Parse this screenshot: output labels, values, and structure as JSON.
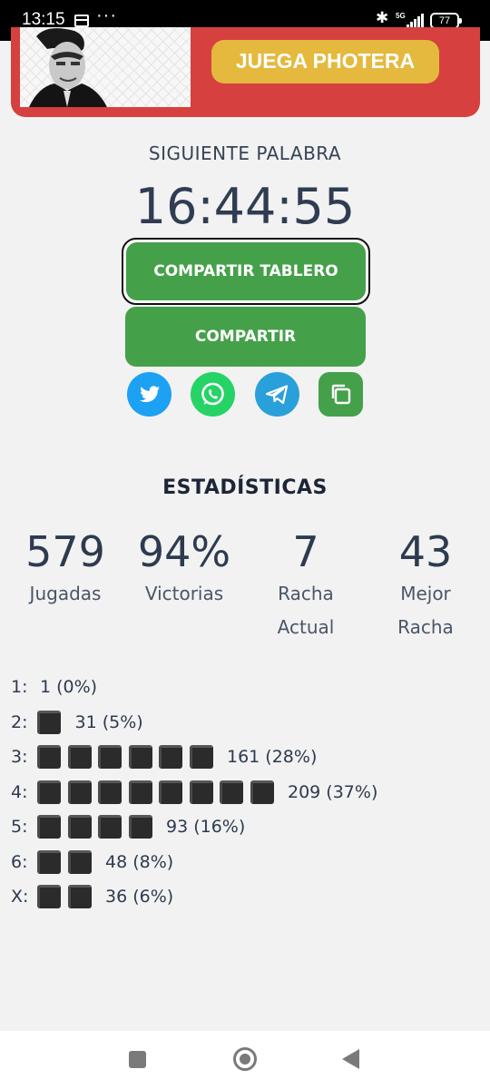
{
  "status_bar": {
    "time": "13:15",
    "more": "···",
    "network": "5G",
    "battery": "77"
  },
  "banner": {
    "button_label": "JUEGA PHOTERA",
    "background_color": "#d6403f",
    "button_color": "#e4b93e"
  },
  "countdown": {
    "label": "SIGUIENTE PALABRA",
    "time": "16:44:55"
  },
  "buttons": {
    "share_board": "COMPARTIR TABLERO",
    "share": "COMPARTIR",
    "accent_color": "#45a04a"
  },
  "social": [
    {
      "name": "twitter-icon"
    },
    {
      "name": "whatsapp-icon"
    },
    {
      "name": "telegram-icon"
    },
    {
      "name": "copy-icon"
    }
  ],
  "statistics": {
    "title": "ESTADÍSTICAS",
    "items": [
      {
        "value": "579",
        "label_1": "Jugadas",
        "label_2": ""
      },
      {
        "value": "94%",
        "label_1": "Victorias",
        "label_2": ""
      },
      {
        "value": "7",
        "label_1": "Racha",
        "label_2": "Actual"
      },
      {
        "value": "43",
        "label_1": "Mejor",
        "label_2": "Racha"
      }
    ]
  },
  "distribution": [
    {
      "key": "1:",
      "squares": 0,
      "text": "1 (0%)"
    },
    {
      "key": "2:",
      "squares": 1,
      "text": "31 (5%)"
    },
    {
      "key": "3:",
      "squares": 6,
      "text": "161 (28%)"
    },
    {
      "key": "4:",
      "squares": 8,
      "text": "209 (37%)"
    },
    {
      "key": "5:",
      "squares": 4,
      "text": "93 (16%)"
    },
    {
      "key": "6:",
      "squares": 2,
      "text": "48 (8%)"
    },
    {
      "key": "X:",
      "squares": 2,
      "text": "36 (6%)"
    }
  ]
}
